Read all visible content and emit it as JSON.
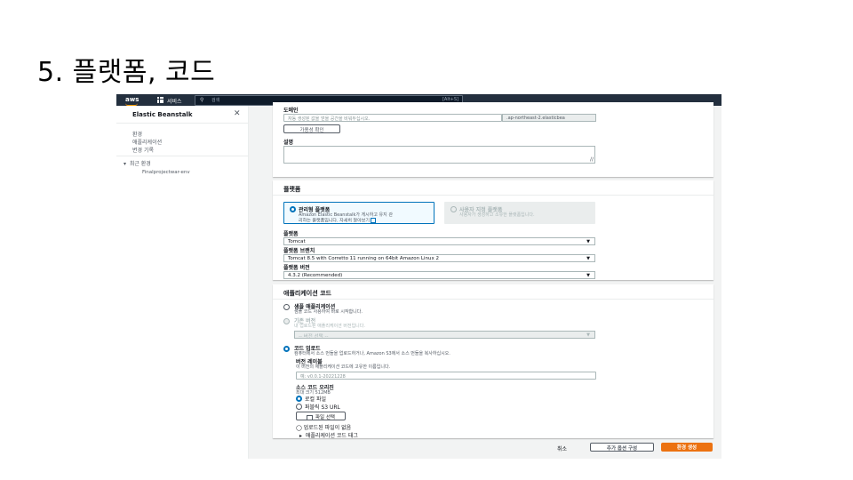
{
  "slide": {
    "title": "5. 플랫폼, 코드"
  },
  "topbar": {
    "logo": "aws",
    "services": "서비스",
    "search_placeholder": "검색",
    "search_shortcut": "[Alt+S]"
  },
  "sidebar": {
    "title": "Elastic Beanstalk",
    "items": [
      "환경",
      "애플리케이션",
      "변경 기록"
    ],
    "recent_label": "최근 환경",
    "recent_env": "Finalprojectwar-env"
  },
  "domain": {
    "label": "도메인",
    "placeholder": "자동 생성된 값을 얻을 공간을 비워두십시오.",
    "suffix": ".ap-northeast-2.elasticbea",
    "check_button": "가용성 확인"
  },
  "description": {
    "label": "설명"
  },
  "platform": {
    "section_title": "플랫폼",
    "managed": {
      "title": "관리형 플랫폼",
      "desc_line1": "Amazon Elastic Beanstalk가 게시하고 유지 관",
      "desc_line2": "리하는 플랫폼입니다. 자세히 알아보기"
    },
    "custom": {
      "title": "사용자 지정 플랫폼",
      "desc": "사용자가 생성하고 소유한 플랫폼입니다."
    },
    "platform_label": "플랫폼",
    "platform_value": "Tomcat",
    "branch_label": "플랫폼 브랜치",
    "branch_value": "Tomcat 8.5 with Corretto 11 running on 64bit Amazon Linux 2",
    "version_label": "플랫폼 버전",
    "version_value": "4.3.2 (Recommended)"
  },
  "app_code": {
    "section_title": "애플리케이션 코드",
    "sample": {
      "title": "샘플 애플리케이션",
      "desc": "샘플 코드 사용하여 바로 시작합니다."
    },
    "existing": {
      "title": "기존 버전",
      "desc": "내 업로드된 애플리케이션 버전입니다.",
      "select_placeholder": "-- 버전 선택 --"
    },
    "upload": {
      "title": "코드 업로드",
      "desc": "컴퓨터에서 소스 번들을 업로드하거나, Amazon S3에서 소스 번들을 복사하십시오."
    },
    "version_label": {
      "title": "버전 레이블",
      "desc": "이 버전의 애플리케이션 코드에 고유한 이름입니다.",
      "placeholder": "예: v0.0.1-20221228"
    },
    "source_origin": {
      "title": "소스 코드 오리진",
      "desc": "최대 크기 512MB"
    },
    "local_file": "로컬 파일",
    "s3_url": "퍼블릭 S3 URL",
    "choose_file": "파일 선택",
    "no_file": "업로드된 파일이 없음",
    "tags": "애플리케이션 코드 태그"
  },
  "footer": {
    "cancel": "취소",
    "more": "추가 옵션 구성",
    "create": "환경 생성"
  }
}
